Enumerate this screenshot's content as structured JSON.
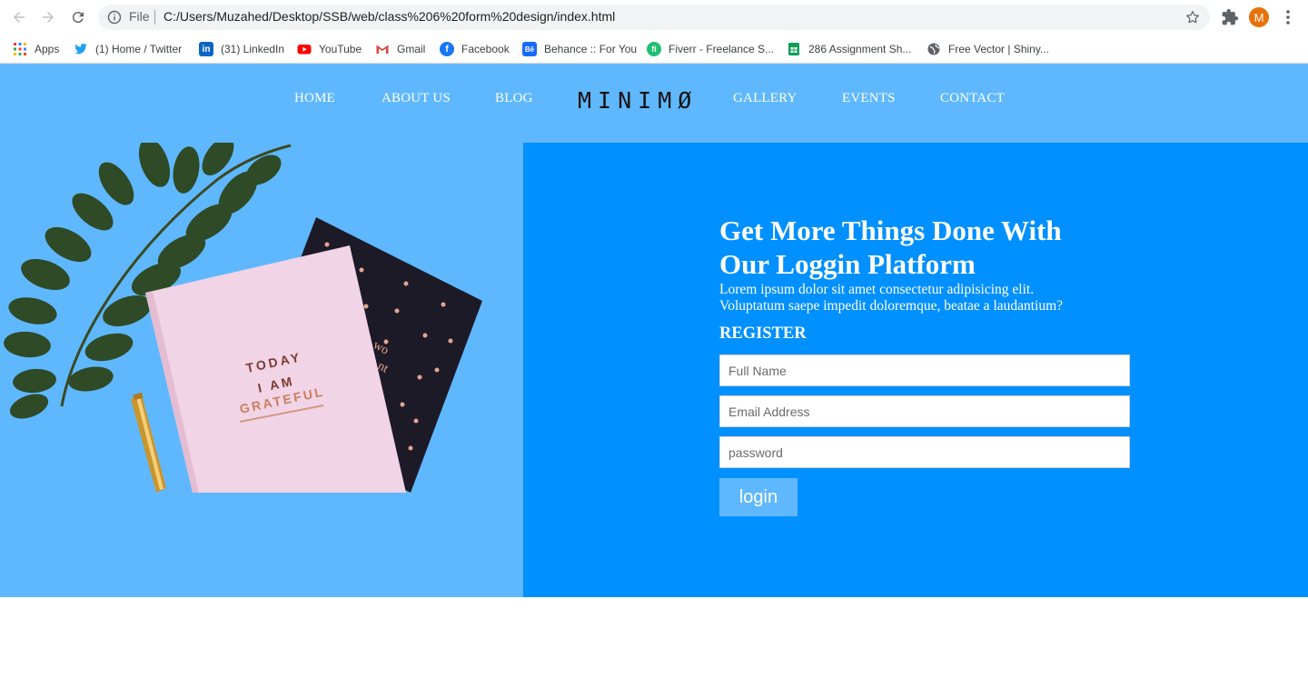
{
  "browser": {
    "omnibox": {
      "scheme_label": "File",
      "url": "C:/Users/Muzahed/Desktop/SSB/web/class%206%20form%20design/index.html"
    },
    "avatar_initial": "M",
    "bookmarks": [
      {
        "label": "Apps",
        "icon": "apps-grid-icon"
      },
      {
        "label": "(1) Home / Twitter",
        "icon": "twitter-icon"
      },
      {
        "label": "(31) LinkedIn",
        "icon": "linkedin-icon"
      },
      {
        "label": "YouTube",
        "icon": "youtube-icon"
      },
      {
        "label": "Gmail",
        "icon": "gmail-icon"
      },
      {
        "label": "Facebook",
        "icon": "facebook-icon"
      },
      {
        "label": "Behance :: For You",
        "icon": "behance-icon"
      },
      {
        "label": "Fiverr - Freelance S...",
        "icon": "fiverr-icon"
      },
      {
        "label": "286 Assignment Sh...",
        "icon": "sheets-icon"
      },
      {
        "label": "Free Vector | Shiny...",
        "icon": "globe-icon"
      }
    ]
  },
  "site": {
    "nav": {
      "home": "HOME",
      "about": "ABOUT US",
      "blog": "BLOG",
      "logo": "MINIMØ",
      "gallery": "GALLERY",
      "events": "EVENTS",
      "contact": "CONTACT"
    },
    "illustration": {
      "notebook_text": [
        "TODAY",
        "I AM",
        "GRATEFUL"
      ],
      "back_notebook_text": [
        "wo",
        "nt"
      ]
    },
    "hero": {
      "title_line1": "Get More Things Done With",
      "title_line2": "Our Loggin Platform",
      "desc_line1": "Lorem ipsum dolor sit amet consectetur adipisicing elit.",
      "desc_line2": "Voluptatum saepe impedit doloremque, beatae a laudantium?",
      "register_label": "REGISTER",
      "fullname_placeholder": "Full Name",
      "email_placeholder": "Email Address",
      "password_placeholder": "password",
      "login_label": "login"
    },
    "colors": {
      "hero_bg": "#5fb8fd",
      "panel_bg": "#0090ff",
      "button_bg": "#5fb8fd"
    }
  }
}
